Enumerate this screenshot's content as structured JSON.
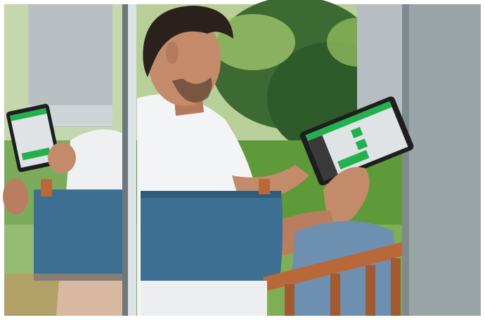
{
  "scene": {
    "description_visible_text": "",
    "colors": {
      "grass": "#5f9a3a",
      "foliage_dark": "#2f5a2a",
      "foliage_light": "#9cc36a",
      "pillar": "#9aa5a8",
      "pillar_dark": "#7f8a8e",
      "glass_frame": "#c9d0d4",
      "chair_canvas": "#3c6f91",
      "chair_wood": "#b9683a",
      "shirt": "#f3f4f6",
      "skin": "#c48b6a",
      "hair": "#2a211d",
      "jeans": "#6d8fb0",
      "tablet_body": "#1e1e1e",
      "tablet_screen": "#dfe3e6",
      "tablet_accent": "#22b14c"
    },
    "icons": [
      "tablet-screen-ui-icon"
    ]
  }
}
